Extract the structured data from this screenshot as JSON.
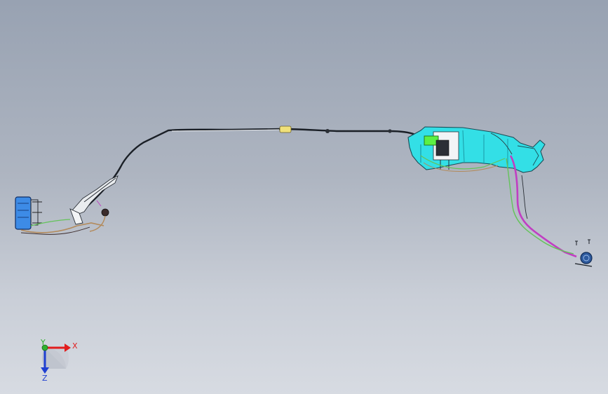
{
  "scene": {
    "background_top": "#98a2b2",
    "background_bottom": "#d7dbe2",
    "assembly_colors": {
      "cable": "#1a1f26",
      "cable_highlight": "#f2f4f6",
      "bracket": "#33dfe6",
      "bracket_dark": "#1b9aa6",
      "wire_green": "#64c35a",
      "wire_magenta": "#c03ec2",
      "wire_tan": "#b38a5a",
      "connector_yellow": "#f0e17a",
      "module_green": "#5cf043",
      "box_blue": "#3d8be6",
      "grommet_blue": "#2e5a9e"
    }
  },
  "triad": {
    "x_label": "X",
    "y_label": "Y",
    "z_label": "Z",
    "x_color": "#e21d1d",
    "y_color": "#2fb12f",
    "z_color": "#1f3fd1"
  }
}
